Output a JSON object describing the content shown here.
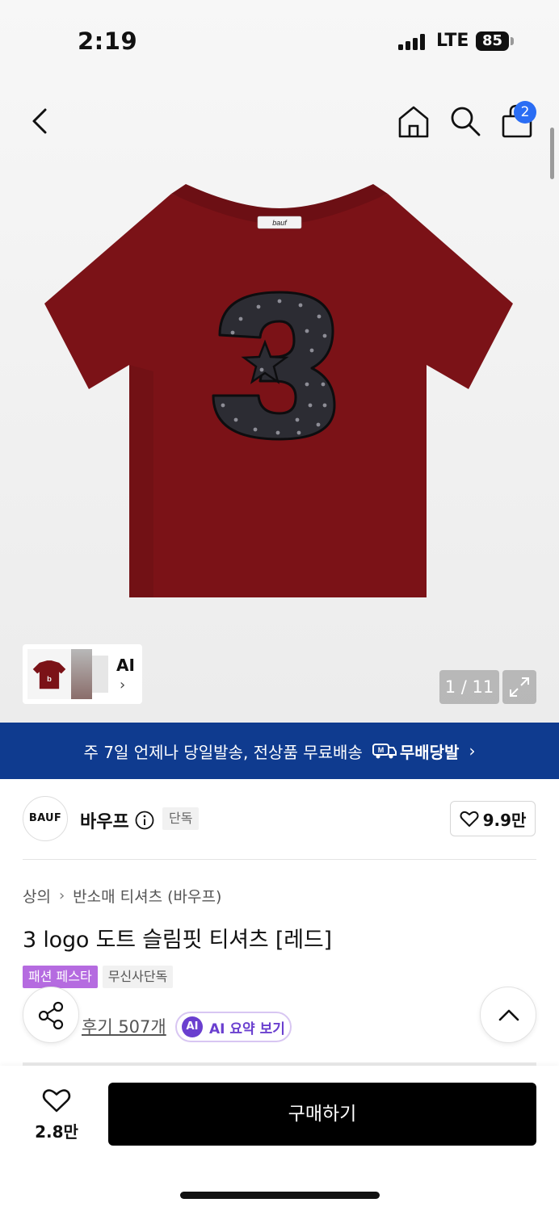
{
  "status": {
    "time": "2:19",
    "network": "LTE",
    "battery": "85"
  },
  "nav": {
    "back_icon": "chevron-left-icon",
    "home_icon": "home-icon",
    "search_icon": "search-icon",
    "bag_icon": "shopping-bag-icon",
    "bag_count": "2"
  },
  "gallery": {
    "thumb_label": "AI",
    "counter": "1 / 11",
    "shirt_color": "#7b1217",
    "logo_text": "bauf"
  },
  "banner": {
    "text": "주 7일 언제나 당일발송, 전상품 무료배송",
    "logo": "무배당발",
    "color": "#0f3b8f"
  },
  "brand": {
    "logo": "BAUF",
    "name": "바우프",
    "tag": "단독",
    "likes": "9.9만"
  },
  "breadcrumb": {
    "category": "상의",
    "subcategory": "반소매 티셔츠 (바우프)"
  },
  "product": {
    "title": "3 logo 도트 슬림핏 티셔츠 [레드]"
  },
  "chips": [
    {
      "label": "패션 페스타"
    },
    {
      "label": "무신사단독"
    }
  ],
  "reviews": {
    "link": "후기 507개",
    "ai_badge": "AI",
    "ai_label": "AI 요약 보기"
  },
  "bottom": {
    "wish_count": "2.8만",
    "buy_label": "구매하기"
  }
}
